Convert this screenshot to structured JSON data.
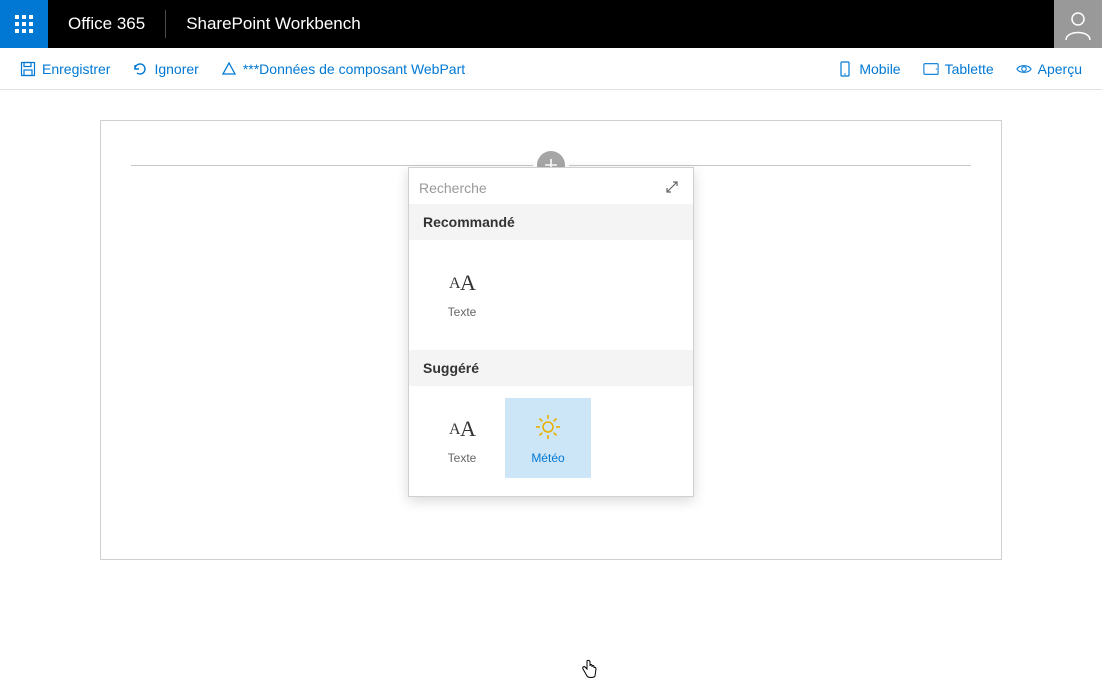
{
  "header": {
    "brand": "Office 365",
    "app_title": "SharePoint Workbench"
  },
  "toolbar": {
    "save": "Enregistrer",
    "discard": "Ignorer",
    "webpart_data": "***Données de composant WebPart",
    "mobile": "Mobile",
    "tablet": "Tablette",
    "preview": "Aperçu"
  },
  "toolbox": {
    "search_placeholder": "Recherche",
    "sections": {
      "featured": {
        "title": "Recommandé",
        "items": [
          {
            "label": "Texte",
            "icon": "text"
          }
        ]
      },
      "suggested": {
        "title": "Suggéré",
        "items": [
          {
            "label": "Texte",
            "icon": "text"
          },
          {
            "label": "Météo",
            "icon": "weather"
          }
        ]
      }
    }
  }
}
